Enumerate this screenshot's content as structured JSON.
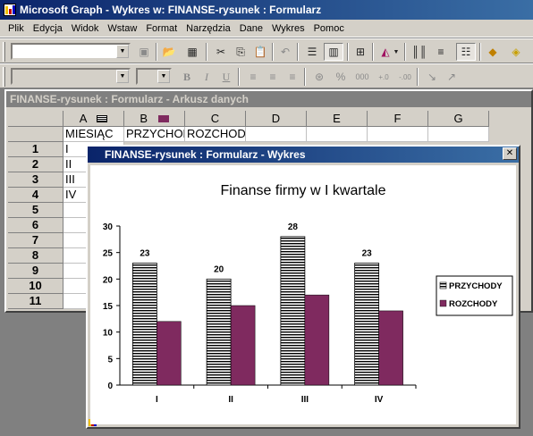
{
  "app": {
    "title": "Microsoft Graph - Wykres w: FINANSE-rysunek : Formularz"
  },
  "menu": [
    "Plik",
    "Edycja",
    "Widok",
    "Wstaw",
    "Format",
    "Narzędzia",
    "Dane",
    "Wykres",
    "Pomoc"
  ],
  "datasheet": {
    "title": "FINANSE-rysunek : Formularz - Arkusz danych",
    "columns": [
      "A",
      "B",
      "C",
      "D",
      "E",
      "F",
      "G"
    ],
    "rows": [
      "1",
      "2",
      "3",
      "4",
      "5",
      "6",
      "7",
      "8",
      "9",
      "10",
      "11"
    ],
    "header_row": [
      "MIESIĄC",
      "PRZYCHODY",
      "ROZCHODY"
    ],
    "month_labels": [
      "I",
      "II",
      "III",
      "IV"
    ]
  },
  "chart_window": {
    "title": "FINANSE-rysunek : Formularz - Wykres"
  },
  "chart_data": {
    "type": "bar",
    "title": "Finanse firmy w I kwartale",
    "categories": [
      "I",
      "II",
      "III",
      "IV"
    ],
    "series": [
      {
        "name": "PRZYCHODY",
        "values": [
          23,
          20,
          28,
          23
        ],
        "color": "#ffffff",
        "pattern": "horizontal-stripes",
        "data_labels": true
      },
      {
        "name": "ROZCHODY",
        "values": [
          12,
          15,
          17,
          14
        ],
        "color": "#7f2a5f"
      }
    ],
    "ylim": [
      0,
      30
    ],
    "yticks": [
      0,
      5,
      10,
      15,
      20,
      25,
      30
    ],
    "legend": "right",
    "grid": false
  }
}
